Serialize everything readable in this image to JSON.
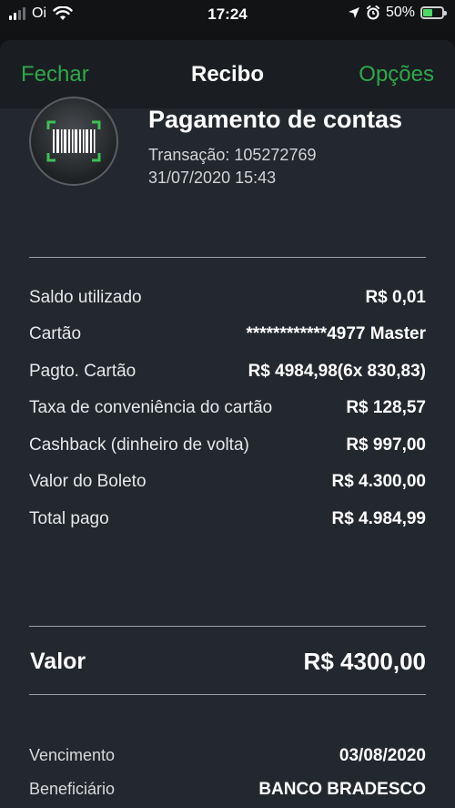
{
  "status_bar": {
    "carrier": "Oi",
    "time": "17:24",
    "battery_percent": "50%",
    "battery_level": 0.5,
    "signal_bars": 4,
    "signal_active": 2,
    "icons": [
      "signal-icon",
      "wifi-icon",
      "location-arrow-icon",
      "alarm-icon",
      "battery-charging-icon"
    ]
  },
  "navbar": {
    "left": "Fechar",
    "title": "Recibo",
    "right": "Opções",
    "accent_color": "#2fa84a"
  },
  "header": {
    "icon": "barcode-icon",
    "title": "Pagamento de contas",
    "transaction": "Transação: 105272769",
    "datetime": "31/07/2020 15:43"
  },
  "details": [
    {
      "label": "Saldo utilizado",
      "value": "R$ 0,01"
    },
    {
      "label": "Cartão",
      "value": "************4977 Master"
    },
    {
      "label": "Pagto. Cartão",
      "value": "R$ 4984,98(6x 830,83)"
    },
    {
      "label": "Taxa de conveniência do cartão",
      "value": "R$ 128,57"
    },
    {
      "label": "Cashback (dinheiro de volta)",
      "value": "R$ 997,00"
    },
    {
      "label": "Valor do Boleto",
      "value": "R$ 4.300,00"
    },
    {
      "label": "Total pago",
      "value": "R$ 4.984,99"
    }
  ],
  "summary": {
    "label": "Valor",
    "value": "R$ 4300,00"
  },
  "extra": [
    {
      "label": "Vencimento",
      "value": "03/08/2020"
    },
    {
      "label": "Beneficiário",
      "value": "BANCO BRADESCO"
    }
  ]
}
